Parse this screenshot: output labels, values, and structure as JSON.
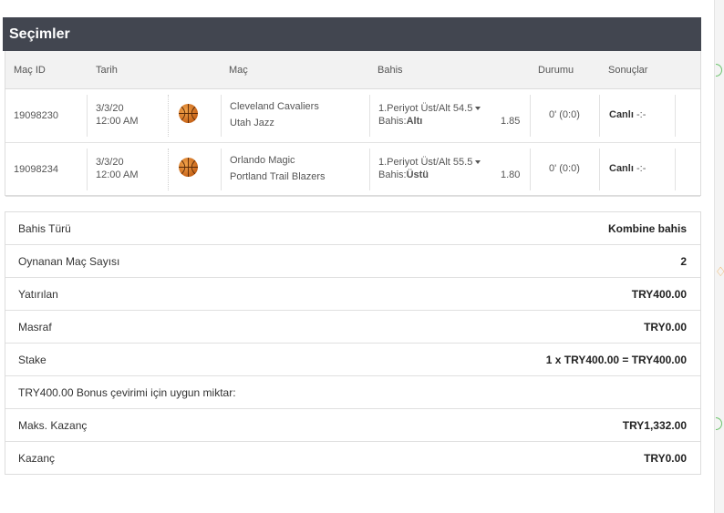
{
  "title": "Seçimler",
  "columns": {
    "mac_id": "Maç ID",
    "tarih": "Tarih",
    "mac": "Maç",
    "bahis": "Bahis",
    "durumu": "Durumu",
    "sonuclar": "Sonuçlar"
  },
  "rows": [
    {
      "id": "19098230",
      "date": "3/3/20",
      "time": "12:00 AM",
      "sport_icon": "basketball-icon",
      "home": "Cleveland Cavaliers",
      "away": "Utah Jazz",
      "market": "1.Periyot Üst/Alt 54.5",
      "bet_prefix": "Bahis:",
      "bet_value": "Altı",
      "odds": "1.85",
      "status": "0' (0:0)",
      "result_state": "Canlı",
      "result_score": "-:-"
    },
    {
      "id": "19098234",
      "date": "3/3/20",
      "time": "12:00 AM",
      "sport_icon": "basketball-icon",
      "home": "Orlando Magic",
      "away": "Portland Trail Blazers",
      "market": "1.Periyot Üst/Alt 55.5",
      "bet_prefix": "Bahis:",
      "bet_value": "Üstü",
      "odds": "1.80",
      "status": "0' (0:0)",
      "result_state": "Canlı",
      "result_score": "-:-"
    }
  ],
  "summary": [
    {
      "label": "Bahis Türü",
      "value": "Kombine bahis"
    },
    {
      "label": "Oynanan Maç Sayısı",
      "value": "2"
    },
    {
      "label": "Yatırılan",
      "value": "TRY400.00"
    },
    {
      "label": "Masraf",
      "value": "TRY0.00"
    },
    {
      "label": "Stake",
      "value": "1 x TRY400.00 = TRY400.00"
    },
    {
      "label": "TRY400.00 Bonus çevirimi için uygun miktar:",
      "value": ""
    },
    {
      "label": "Maks. Kazanç",
      "value": "TRY1,332.00"
    },
    {
      "label": "Kazanç",
      "value": "TRY0.00"
    }
  ],
  "colors": {
    "title_bar": "#424650",
    "header_bg": "#f2f2f2",
    "accent_green": "#6cc36c",
    "accent_orange": "#f0a040"
  }
}
